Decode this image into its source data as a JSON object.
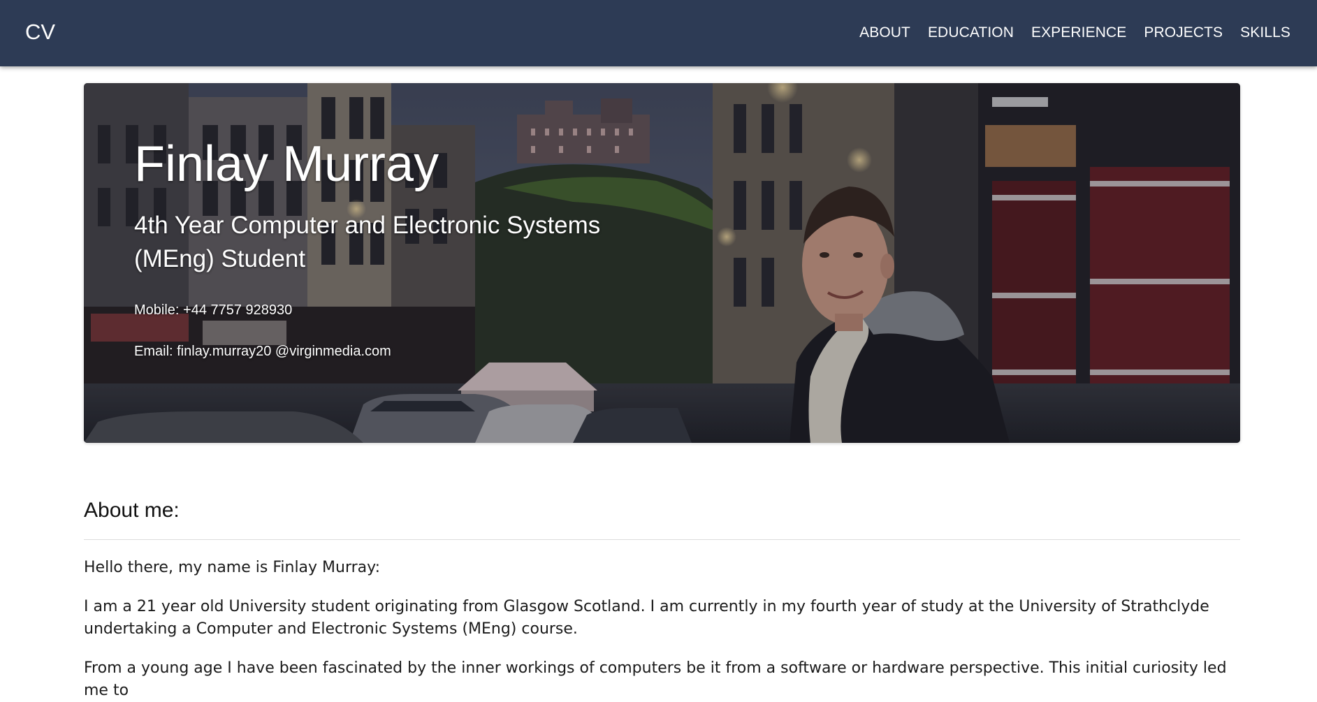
{
  "navbar": {
    "brand": "CV",
    "links": [
      "ABOUT",
      "EDUCATION",
      "EXPERIENCE",
      "PROJECTS",
      "SKILLS"
    ],
    "background": "#2d3b55"
  },
  "hero": {
    "name": "Finlay Murray",
    "subtitle": "4th Year Computer and Electronic Systems (MEng) Student",
    "mobile": "Mobile: +44 7757 928930",
    "email": "Email: finlay.murray20 @virginmedia.com",
    "image": "photo of a man smiling on an evening street with a castle on a hill in the background"
  },
  "about": {
    "heading": "About me:",
    "paragraphs": [
      "Hello there, my name is Finlay Murray:",
      "I am a 21 year old University student originating from Glasgow Scotland. I am currently in my fourth year of study at the University of Strathclyde undertaking a Computer and Electronic Systems (MEng) course.",
      "From a young age I have been fascinated by the inner workings of computers be it from a software or hardware perspective. This initial curiosity led me to"
    ]
  }
}
